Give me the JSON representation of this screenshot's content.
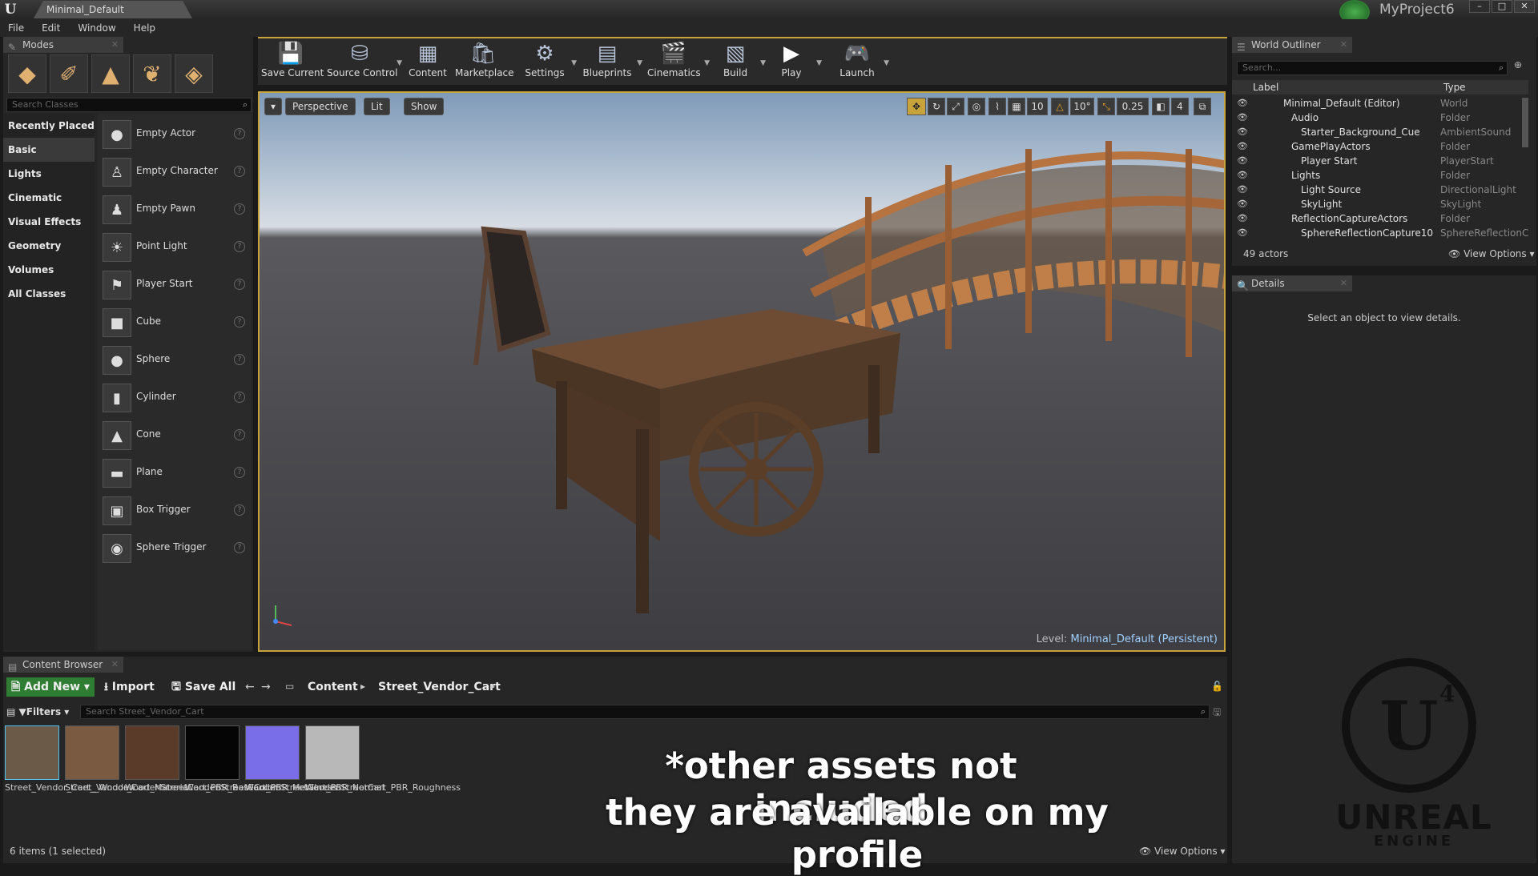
{
  "window": {
    "doc_tab": "Minimal_Default",
    "project": "MyProject6",
    "ue_icon": "ue-logo"
  },
  "menu": [
    "File",
    "Edit",
    "Window",
    "Help"
  ],
  "modes": {
    "tab": "Modes",
    "search_placeholder": "Search Classes",
    "categories": [
      "Recently Placed",
      "Basic",
      "Lights",
      "Cinematic",
      "Visual Effects",
      "Geometry",
      "Volumes",
      "All Classes"
    ],
    "selected_category": "Basic",
    "actors": [
      "Empty Actor",
      "Empty Character",
      "Empty Pawn",
      "Point Light",
      "Player Start",
      "Cube",
      "Sphere",
      "Cylinder",
      "Cone",
      "Plane",
      "Box Trigger",
      "Sphere Trigger"
    ]
  },
  "toolbar": [
    "Save Current",
    "Source Control",
    "Content",
    "Marketplace",
    "Settings",
    "Blueprints",
    "Cinematics",
    "Build",
    "Play",
    "Launch"
  ],
  "viewport": {
    "perspective": "Perspective",
    "lit": "Lit",
    "show": "Show",
    "grid": "10",
    "rot": "10°",
    "scale": "0.25",
    "cam": "4",
    "level_prefix": "Level:",
    "level": "Minimal_Default (Persistent)"
  },
  "outliner": {
    "tab": "World Outliner",
    "search_placeholder": "Search...",
    "col_label": "Label",
    "col_type": "Type",
    "rows": [
      {
        "name": "Minimal_Default (Editor)",
        "type": "World"
      },
      {
        "name": "Audio",
        "type": "Folder"
      },
      {
        "name": "Starter_Background_Cue",
        "type": "AmbientSound"
      },
      {
        "name": "GamePlayActors",
        "type": "Folder"
      },
      {
        "name": "Player Start",
        "type": "PlayerStart"
      },
      {
        "name": "Lights",
        "type": "Folder"
      },
      {
        "name": "Light Source",
        "type": "DirectionalLight"
      },
      {
        "name": "SkyLight",
        "type": "SkyLight"
      },
      {
        "name": "ReflectionCaptureActors",
        "type": "Folder"
      },
      {
        "name": "SphereReflectionCapture10",
        "type": "SphereReflectionC"
      }
    ],
    "count": "49 actors",
    "view_options": "View Options"
  },
  "details": {
    "tab": "Details",
    "empty_text": "Select an object to view details."
  },
  "content_browser": {
    "tab": "Content Browser",
    "add_new": "Add New",
    "import": "Import",
    "save_all": "Save All",
    "path": [
      "Content",
      "Street_Vendor_Cart"
    ],
    "filters": "Filters",
    "search_placeholder": "Search Street_Vendor_Cart",
    "assets": [
      {
        "name": "Street_Vendor_Cart__Wooden",
        "color": "#6b5a48"
      },
      {
        "name": "Street_Vendor_Cart_Material",
        "color": "#7a5a40"
      },
      {
        "name": "WoodenStreetCart_PBR_BaseColor",
        "color": "#5a3a28"
      },
      {
        "name": "WoodenStreetCart_PBR_Metalness",
        "color": "#050505"
      },
      {
        "name": "WoodenStreetCart_PBR_Normal",
        "color": "#7a6ee8"
      },
      {
        "name": "WoodenStreetCart_PBR_Roughness",
        "color": "#b8b8b8"
      }
    ],
    "status": "6 items (1 selected)",
    "view_options": "View Options"
  },
  "overlay": {
    "line1": "*other assets not included",
    "line2": "they are available on my profile"
  },
  "brand": {
    "unreal": "UNREAL",
    "engine": "ENGINE",
    "version": "4"
  }
}
